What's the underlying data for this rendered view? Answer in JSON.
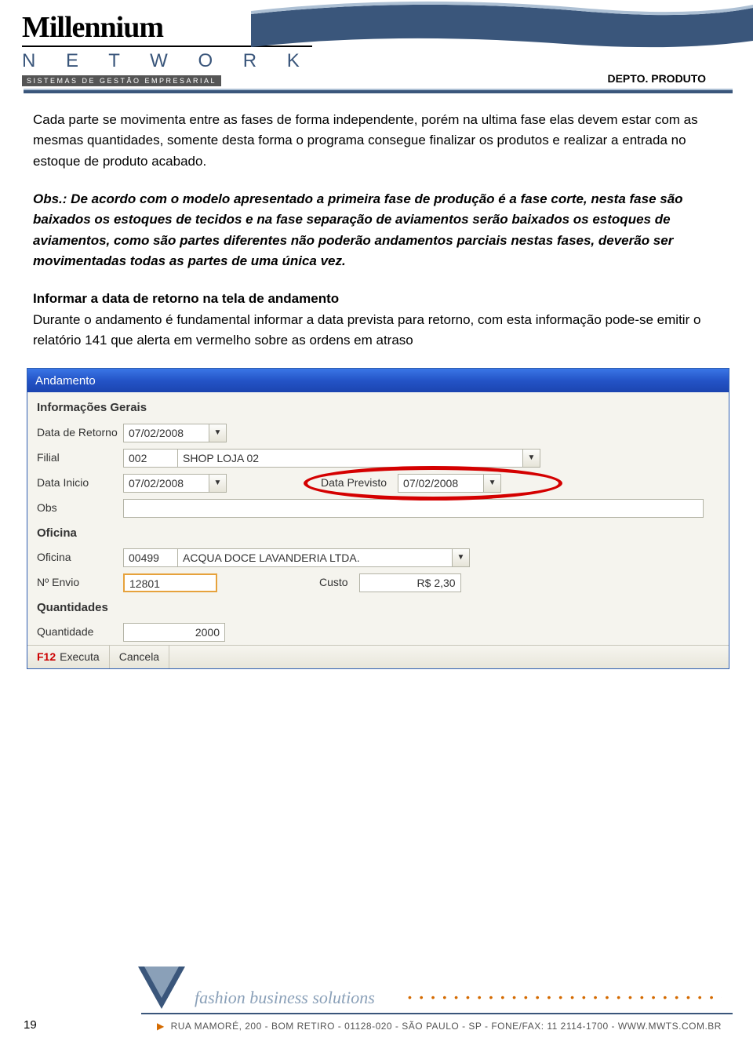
{
  "header": {
    "logo_main": "Millennium",
    "logo_sub": "N E T W O R K",
    "logo_tag": "SISTEMAS DE GESTÃO EMPRESARIAL",
    "department": "DEPTO. PRODUTO"
  },
  "body": {
    "para1": "Cada parte se movimenta entre as fases de forma independente, porém na ultima fase elas devem estar com as mesmas quantidades, somente desta forma o programa consegue finalizar os produtos e realizar a entrada no estoque de produto acabado.",
    "obs": "Obs.: De acordo com o modelo apresentado a primeira fase de produção é a fase corte, nesta fase são baixados os estoques de tecidos e na fase separação de aviamentos serão baixados os estoques de aviamentos, como são partes diferentes não poderão andamentos parciais nestas fases, deverão ser movimentadas todas as partes de uma única vez.",
    "subhead": "Informar a data de retorno na tela de andamento",
    "para2": "Durante o andamento é fundamental informar a data prevista para retorno, com esta informação pode-se emitir o relatório 141 que alerta em vermelho sobre as ordens em atraso"
  },
  "window": {
    "title": "Andamento",
    "sections": {
      "geral": "Informações Gerais",
      "oficina": "Oficina",
      "quantidades": "Quantidades"
    },
    "fields": {
      "data_retorno_label": "Data de Retorno",
      "data_retorno_value": "07/02/2008",
      "filial_label": "Filial",
      "filial_code": "002",
      "filial_name": "SHOP LOJA 02",
      "data_inicio_label": "Data Inicio",
      "data_inicio_value": "07/02/2008",
      "data_previsto_label": "Data Previsto",
      "data_previsto_value": "07/02/2008",
      "obs_label": "Obs",
      "obs_value": "",
      "oficina_label": "Oficina",
      "oficina_code": "00499",
      "oficina_name": "ACQUA DOCE LAVANDERIA LTDA.",
      "envio_label": "Nº Envio",
      "envio_value": "12801",
      "custo_label": "Custo",
      "custo_value": "R$ 2,30",
      "quantidade_label": "Quantidade",
      "quantidade_value": "2000"
    },
    "statusbar": {
      "f12": "F12",
      "executa": "Executa",
      "cancela": "Cancela"
    }
  },
  "footer": {
    "fashion": "fashion business solutions",
    "address": "RUA MAMORÉ, 200 - BOM RETIRO - 01128-020 - SÃO PAULO - SP - FONE/FAX: 11 2114-1700 - WWW.MWTS.COM.BR",
    "page": "19"
  }
}
